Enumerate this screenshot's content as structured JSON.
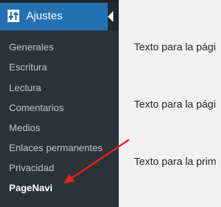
{
  "sidebar": {
    "section_title": "Ajustes",
    "section_icon": "settings-sliders-icon",
    "items": [
      {
        "label": "Generales"
      },
      {
        "label": "Escritura"
      },
      {
        "label": "Lectura"
      },
      {
        "label": "Comentarios"
      },
      {
        "label": "Medios"
      },
      {
        "label": "Enlaces permanentes"
      },
      {
        "label": "Privacidad"
      },
      {
        "label": "PageNavi",
        "current": true
      }
    ]
  },
  "content": {
    "lines": [
      "Texto para la págin",
      "Texto para la págin",
      "Texto para la prim"
    ]
  },
  "colors": {
    "accent": "#2271b1",
    "sidebar": "#2c3338",
    "annotation_arrow": "#e5231b"
  }
}
